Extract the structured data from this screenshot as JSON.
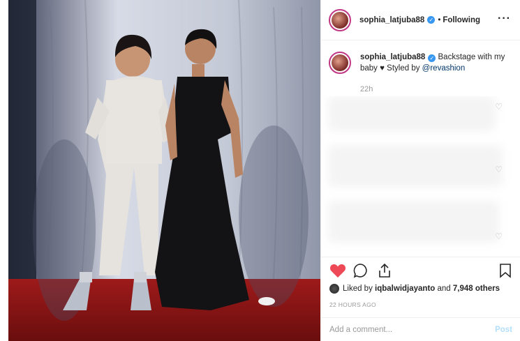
{
  "header": {
    "username": "sophia_latjuba88",
    "separator": "•",
    "following_label": "Following",
    "more_label": "···"
  },
  "caption": {
    "username": "sophia_latjuba88",
    "text_before": "Backstage with my baby ♥ Styled by",
    "mention": "@revashion",
    "time": "22h"
  },
  "likes": {
    "prefix": "Liked by",
    "user": "iqbalwidjayanto",
    "middle": "and",
    "count": "7,948 others"
  },
  "timestamp": "22 HOURS AGO",
  "comment_box": {
    "placeholder": "Add a comment...",
    "post_label": "Post"
  },
  "colors": {
    "like_red": "#ed4956",
    "verified_blue": "#3897f0",
    "post_disabled": "#b2dffc"
  },
  "icons": [
    "heart-filled-icon",
    "comment-icon",
    "share-icon",
    "bookmark-icon",
    "verified-badge-icon",
    "heart-outline-icon",
    "more-icon"
  ]
}
